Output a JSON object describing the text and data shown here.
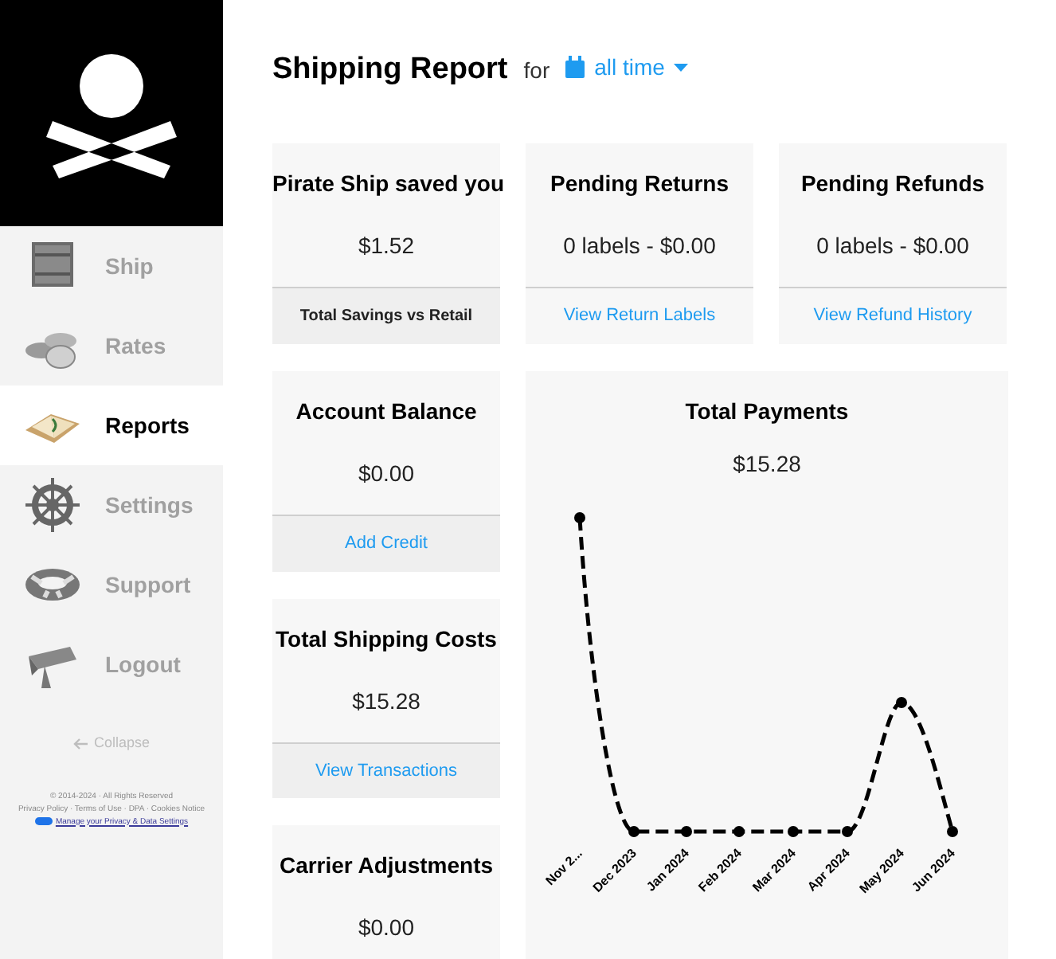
{
  "sidebar": {
    "items": [
      {
        "label": "Ship",
        "selected": false
      },
      {
        "label": "Rates",
        "selected": false
      },
      {
        "label": "Reports",
        "selected": true
      },
      {
        "label": "Settings",
        "selected": false
      },
      {
        "label": "Support",
        "selected": false
      },
      {
        "label": "Logout",
        "selected": false
      }
    ],
    "collapse": "Collapse",
    "footer": {
      "copyright": "© 2014-2024 · All Rights Reserved",
      "links": "Privacy Policy · Terms of Use · DPA · Cookies Notice",
      "privacy": "Manage your Privacy & Data Settings"
    }
  },
  "header": {
    "title": "Shipping Report",
    "for": "for",
    "range": "all time"
  },
  "cards": [
    {
      "title": "Pirate Ship saved you",
      "value": "$1.52",
      "footer": "Total Savings vs Retail",
      "kind": "label"
    },
    {
      "title": "Pending Returns",
      "value": "0 labels - $0.00",
      "footer": "View Return Labels",
      "kind": "link"
    },
    {
      "title": "Pending Refunds",
      "value": "0 labels - $0.00",
      "footer": "View Refund History",
      "kind": "link"
    }
  ],
  "side_cards": [
    {
      "title": "Account Balance",
      "value": "$0.00",
      "footer": "Add Credit"
    },
    {
      "title": "Total Shipping Costs",
      "value": "$15.28",
      "footer": "View Transactions"
    },
    {
      "title": "Carrier Adjustments",
      "value": "$0.00"
    }
  ],
  "payments": {
    "title": "Total Payments",
    "value": "$15.28",
    "x_labels": [
      "Nov 2...",
      "Dec 2023",
      "Jan 2024",
      "Feb 2024",
      "Mar 2024",
      "Apr 2024",
      "May 2024",
      "Jun 2024"
    ]
  }
}
